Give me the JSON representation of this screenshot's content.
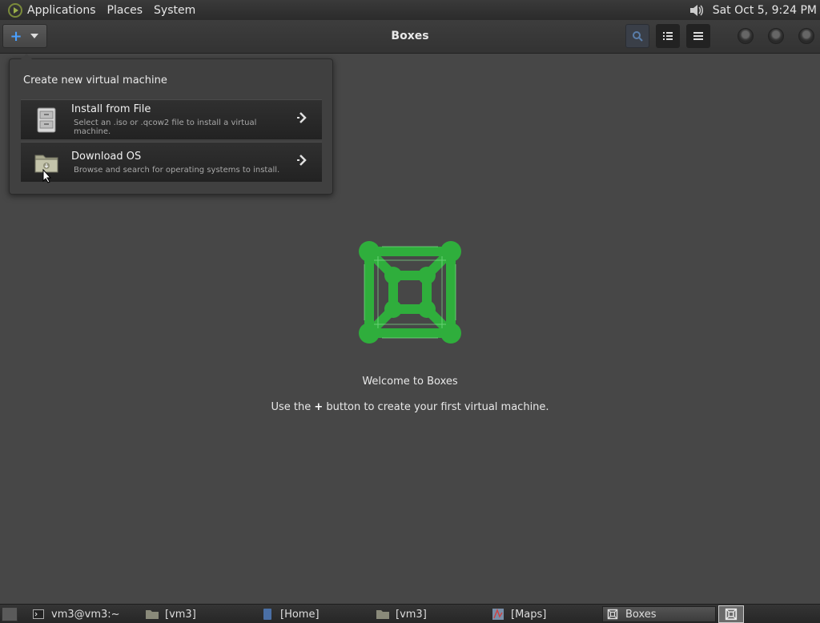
{
  "top_panel": {
    "menus": [
      "Applications",
      "Places",
      "System"
    ],
    "clock": "Sat Oct  5,  9:24 PM"
  },
  "header": {
    "title": "Boxes",
    "new_button_plus": "+"
  },
  "popover": {
    "title": "Create new virtual machine",
    "items": [
      {
        "label": "Install from File",
        "description": "Select an .iso or .qcow2 file to install a virtual machine."
      },
      {
        "label": "Download OS",
        "description": "Browse and search for operating systems to install."
      }
    ]
  },
  "welcome": {
    "heading": "Welcome to Boxes",
    "hint_before": "Use the ",
    "hint_plus": "+",
    "hint_after": " button to create your first virtual machine."
  },
  "taskbar": {
    "tasks": [
      {
        "label": "vm3@vm3:~",
        "icon": "terminal-icon"
      },
      {
        "label": "[vm3]",
        "icon": "folder-icon"
      },
      {
        "label": "[Home]",
        "icon": "text-editor-icon"
      },
      {
        "label": "[vm3]",
        "icon": "folder-icon"
      },
      {
        "label": "[Maps]",
        "icon": "maps-icon"
      },
      {
        "label": "Boxes",
        "icon": "boxes-icon"
      }
    ]
  },
  "colors": {
    "accent_blue": "#4aa0ff",
    "boxes_green": "#2fae3c"
  }
}
